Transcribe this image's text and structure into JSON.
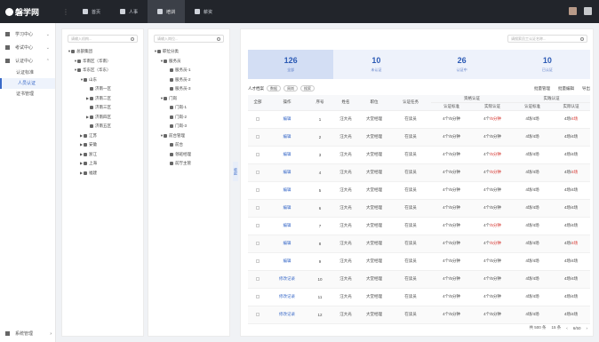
{
  "logo": {
    "text": "磐学网"
  },
  "top_nav": [
    {
      "label": "首页",
      "active": false
    },
    {
      "label": "人事",
      "active": false
    },
    {
      "label": "培训",
      "active": true
    },
    {
      "label": "薪资",
      "active": false
    }
  ],
  "sidebar": {
    "items": [
      {
        "label": "学习中心"
      },
      {
        "label": "考试中心"
      },
      {
        "label": "认证中心"
      }
    ],
    "sub_items": [
      {
        "label": "认证标准",
        "active": false
      },
      {
        "label": "人员认证",
        "active": true
      },
      {
        "label": "证书管理",
        "active": false
      }
    ],
    "bottom": {
      "label": "系统管理"
    }
  },
  "org_tree": {
    "search_placeholder": "请输入机构...",
    "nodes": [
      {
        "label": "总部集团",
        "level": 0,
        "arrow": "▼"
      },
      {
        "label": "华南区（华南）",
        "level": 1,
        "arrow": "▼"
      },
      {
        "label": "华东区（华东）",
        "level": 1,
        "arrow": "▼"
      },
      {
        "label": "山东",
        "level": 2,
        "arrow": "▼"
      },
      {
        "label": "济南一区",
        "level": 3,
        "arrow": ""
      },
      {
        "label": "济南二区",
        "level": 3,
        "arrow": "▶"
      },
      {
        "label": "济南三区",
        "level": 3,
        "arrow": ""
      },
      {
        "label": "济南四区",
        "level": 3,
        "arrow": "▶"
      },
      {
        "label": "济南五区",
        "level": 3,
        "arrow": ""
      },
      {
        "label": "江苏",
        "level": 2,
        "arrow": "▶"
      },
      {
        "label": "安徽",
        "level": 2,
        "arrow": "▶"
      },
      {
        "label": "浙江",
        "level": 2,
        "arrow": "▶"
      },
      {
        "label": "上海",
        "level": 2,
        "arrow": "▶"
      },
      {
        "label": "福建",
        "level": 2,
        "arrow": "▶"
      }
    ]
  },
  "job_tree": {
    "search_placeholder": "请输入岗位...",
    "nodes": [
      {
        "label": "职位分类",
        "level": 0,
        "arrow": "▼"
      },
      {
        "label": "服务员",
        "level": 1,
        "arrow": "▼"
      },
      {
        "label": "服务员-1",
        "level": 2,
        "arrow": ""
      },
      {
        "label": "服务员-2",
        "level": 2,
        "arrow": ""
      },
      {
        "label": "服务员-3",
        "level": 2,
        "arrow": ""
      },
      {
        "label": "门岗",
        "level": 1,
        "arrow": "▼"
      },
      {
        "label": "门岗-1",
        "level": 2,
        "arrow": ""
      },
      {
        "label": "门岗-2",
        "level": 2,
        "arrow": ""
      },
      {
        "label": "门岗-3",
        "level": 2,
        "arrow": ""
      },
      {
        "label": "前台管理",
        "level": 1,
        "arrow": "▼"
      },
      {
        "label": "前台",
        "level": 2,
        "arrow": ""
      },
      {
        "label": "领班经理",
        "level": 2,
        "arrow": ""
      },
      {
        "label": "前厅主管",
        "level": 2,
        "arrow": ""
      }
    ]
  },
  "collapse_label": "收起",
  "main": {
    "search_placeholder": "请搜索员工认证名称...",
    "stats": [
      {
        "n": "126",
        "l": "全部",
        "active": true
      },
      {
        "n": "10",
        "l": "未认证",
        "active": false
      },
      {
        "n": "26",
        "l": "认证中",
        "active": false
      },
      {
        "n": "10",
        "l": "已认证",
        "active": false
      }
    ],
    "filter_label": "人才档案",
    "filter_tags": [
      "数据",
      "周岗",
      "搜索"
    ],
    "actions": [
      "批量管理",
      "批量编辑",
      "导出"
    ],
    "columns": [
      "全部",
      "操作",
      "序号",
      "姓名",
      "职位",
      "认证任务",
      "认证标准",
      "实际认证",
      "认证标准",
      "实际认证"
    ],
    "group_headers": [
      "资格认证",
      "实践认证"
    ],
    "rows": [
      {
        "op": "编辑",
        "no": "1",
        "name": "汪大光",
        "pos": "大堂经理",
        "task": "在读员",
        "std1": "4个/5分钟",
        "act1": "4个",
        "act1b": "/5分钟",
        "std2": "4场/4场",
        "act2": "4场/",
        "act2b": "4场",
        "r1": true,
        "r2": true
      },
      {
        "op": "编辑",
        "no": "2",
        "name": "汪大光",
        "pos": "大堂经理",
        "task": "在读员",
        "std1": "4个/5分钟",
        "act1": "4个/5分钟",
        "act1b": "",
        "std2": "4场/4场",
        "act2": "4场/4场",
        "act2b": "",
        "r1": false,
        "r2": false
      },
      {
        "op": "编辑",
        "no": "3",
        "name": "汪大光",
        "pos": "大堂经理",
        "task": "在读员",
        "std1": "4个/5分钟",
        "act1": "4个",
        "act1b": "/5分钟",
        "std2": "4场/4场",
        "act2": "4场/4场",
        "act2b": "",
        "r1": true,
        "r2": false
      },
      {
        "op": "编辑",
        "no": "4",
        "name": "汪大光",
        "pos": "大堂经理",
        "task": "在读员",
        "std1": "4个/5分钟",
        "act1": "4个",
        "act1b": "/5分钟",
        "std2": "4场/4场",
        "act2": "4场/",
        "act2b": "4场",
        "r1": true,
        "r2": true
      },
      {
        "op": "编辑",
        "no": "5",
        "name": "汪大光",
        "pos": "大堂经理",
        "task": "在读员",
        "std1": "4个/5分钟",
        "act1": "4个/5分钟",
        "act1b": "",
        "std2": "4场/4场",
        "act2": "4场/4场",
        "act2b": "",
        "r1": false,
        "r2": false
      },
      {
        "op": "编辑",
        "no": "6",
        "name": "汪大光",
        "pos": "大堂经理",
        "task": "在读员",
        "std1": "4个/5分钟",
        "act1": "4个/5分钟",
        "act1b": "",
        "std2": "4场/4场",
        "act2": "4场/4场",
        "act2b": "",
        "r1": false,
        "r2": false
      },
      {
        "op": "编辑",
        "no": "7",
        "name": "汪大光",
        "pos": "大堂经理",
        "task": "在读员",
        "std1": "4个/5分钟",
        "act1": "4个",
        "act1b": "/5分钟",
        "std2": "4场/4场",
        "act2": "4场/4场",
        "act2b": "",
        "r1": true,
        "r2": false
      },
      {
        "op": "编辑",
        "no": "8",
        "name": "汪大光",
        "pos": "大堂经理",
        "task": "在读员",
        "std1": "4个/5分钟",
        "act1": "4个",
        "act1b": "/5分钟",
        "std2": "4场/4场",
        "act2": "4场/",
        "act2b": "4场",
        "r1": true,
        "r2": true
      },
      {
        "op": "编辑",
        "no": "9",
        "name": "汪大光",
        "pos": "大堂经理",
        "task": "在读员",
        "std1": "4个/5分钟",
        "act1": "4个/5分钟",
        "act1b": "",
        "std2": "4场/4场",
        "act2": "4场/4场",
        "act2b": "",
        "r1": false,
        "r2": false
      },
      {
        "op": "修改记录",
        "no": "10",
        "name": "汪大光",
        "pos": "大堂经理",
        "task": "在读员",
        "std1": "4个/5分钟",
        "act1": "4个/5分钟",
        "act1b": "",
        "std2": "4场/4场",
        "act2": "4场/4场",
        "act2b": "",
        "r1": false,
        "r2": false
      },
      {
        "op": "修改记录",
        "no": "11",
        "name": "汪大光",
        "pos": "大堂经理",
        "task": "在读员",
        "std1": "4个/5分钟",
        "act1": "4个/5分钟",
        "act1b": "",
        "std2": "4场/4场",
        "act2": "4场/4场",
        "act2b": "",
        "r1": false,
        "r2": false
      },
      {
        "op": "修改记录",
        "no": "12",
        "name": "汪大光",
        "pos": "大堂经理",
        "task": "在读员",
        "std1": "4个/5分钟",
        "act1": "4个/5分钟",
        "act1b": "",
        "std2": "4场/4场",
        "act2": "4场/4场",
        "act2b": "",
        "r1": false,
        "r2": false
      }
    ],
    "pager": {
      "total": "共 500 条",
      "size": "15 条",
      "page": "6/50"
    }
  },
  "colors": {
    "accent": "#3a6ac8",
    "danger": "#d4302a",
    "topbar": "#22252b"
  }
}
